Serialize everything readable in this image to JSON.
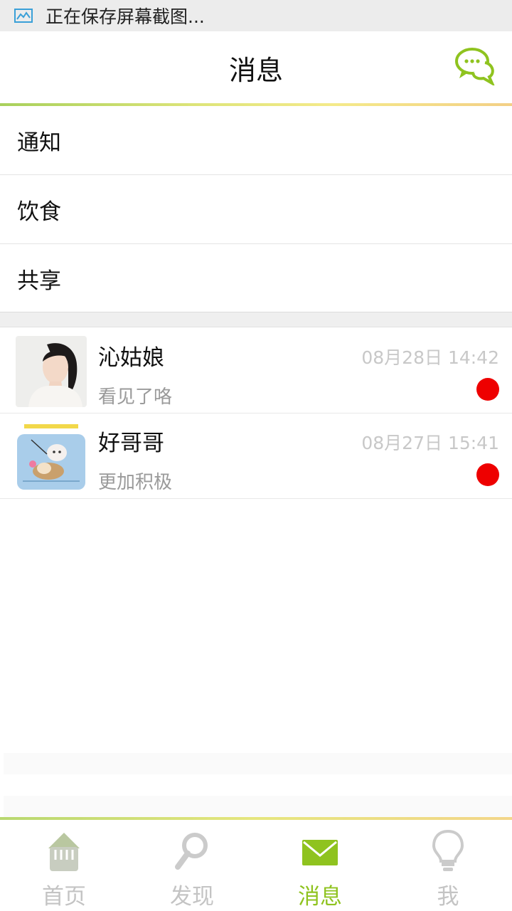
{
  "status_bar": {
    "text": "正在保存屏幕截图..."
  },
  "header": {
    "title": "消息"
  },
  "menu": [
    {
      "label": "通知"
    },
    {
      "label": "饮食"
    },
    {
      "label": "共享"
    }
  ],
  "conversations": [
    {
      "name": "沁姑娘",
      "time": "08月28日 14:42",
      "preview": "看见了咯",
      "unread": true
    },
    {
      "name": "好哥哥",
      "time": "08月27日 15:41",
      "preview": "更加积极",
      "unread": true
    }
  ],
  "tabs": [
    {
      "label": "首页",
      "icon": "home-icon",
      "active": false
    },
    {
      "label": "发现",
      "icon": "search-icon",
      "active": false
    },
    {
      "label": "消息",
      "icon": "mail-icon",
      "active": true
    },
    {
      "label": "我",
      "icon": "lightbulb-icon",
      "active": false
    }
  ],
  "colors": {
    "accent": "#8fc31f",
    "unread": "#ee0000",
    "muted_text": "#9a9a9a",
    "time_text": "#c8c8c8"
  }
}
